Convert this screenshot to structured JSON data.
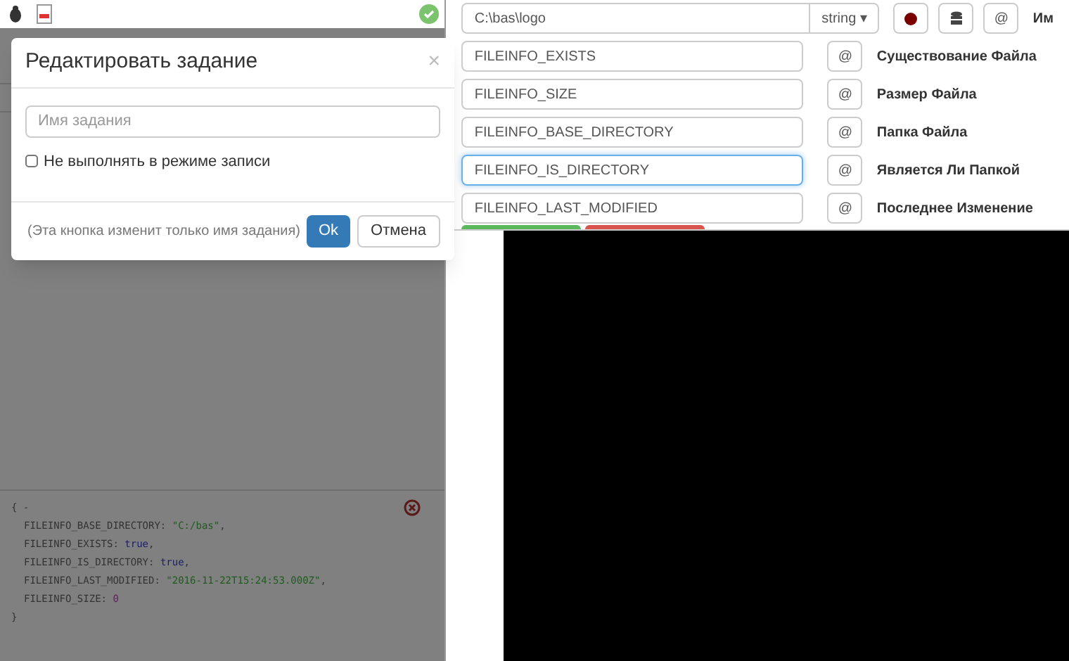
{
  "modal": {
    "title": "Редактировать задание",
    "close": "×",
    "name_field": {
      "placeholder": "Имя задания"
    },
    "checkbox": {
      "label": "Не выполнять в режиме записи",
      "checked": false
    },
    "hint": "(Эта кнопка изменит только имя задания)",
    "ok": "Ok",
    "cancel": "Отмена"
  },
  "console": {
    "open": "{ -",
    "close": "}",
    "lines": [
      {
        "key": "FILEINFO_BASE_DIRECTORY:",
        "value": "\"C:/bas\"",
        "kind": "string",
        "comma": ","
      },
      {
        "key": "FILEINFO_EXISTS:",
        "value": "true",
        "kind": "bool",
        "comma": ","
      },
      {
        "key": "FILEINFO_IS_DIRECTORY:",
        "value": "true",
        "kind": "bool",
        "comma": ","
      },
      {
        "key": "FILEINFO_LAST_MODIFIED:",
        "value": "\"2016-11-22T15:24:53.000Z\"",
        "kind": "string",
        "comma": ","
      },
      {
        "key": "FILEINFO_SIZE:",
        "value": "0",
        "kind": "number"
      }
    ]
  },
  "path_field": {
    "value": "C:\\bas\\logo",
    "type": "string ▾"
  },
  "toolbar_label": "Им",
  "outputs": [
    {
      "value": "FILEINFO_EXISTS",
      "at": "@",
      "label": "Существование Файла",
      "focused": false
    },
    {
      "value": "FILEINFO_SIZE",
      "at": "@",
      "label": "Размер Файла",
      "focused": false
    },
    {
      "value": "FILEINFO_BASE_DIRECTORY",
      "at": "@",
      "label": "Папка Файла",
      "focused": false
    },
    {
      "value": "FILEINFO_IS_DIRECTORY",
      "at": "@",
      "label": "Является Ли Папкой",
      "focused": true
    },
    {
      "value": "FILEINFO_LAST_MODIFIED",
      "at": "@",
      "label": "Последнее Изменение",
      "focused": false
    }
  ],
  "toolbar_at": "@"
}
